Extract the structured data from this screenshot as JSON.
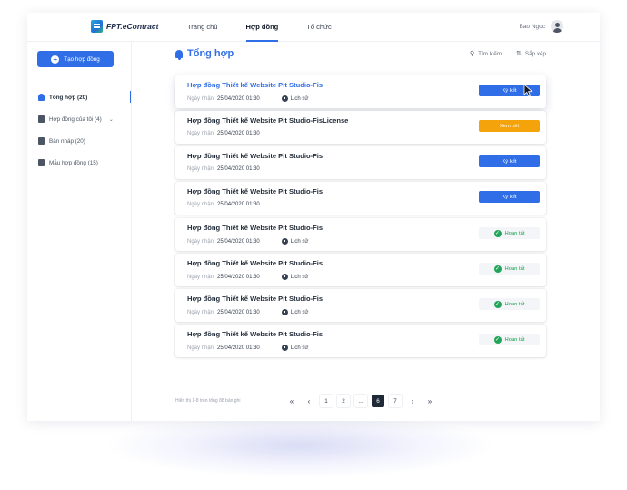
{
  "app": {
    "logo_text": "FPT.eContract"
  },
  "nav": {
    "items": [
      {
        "label": "Trang chủ",
        "active": false
      },
      {
        "label": "Hợp đồng",
        "active": true
      },
      {
        "label": "Tổ chức",
        "active": false
      }
    ]
  },
  "user": {
    "name": "Bao Ngoc"
  },
  "sidebar": {
    "create_label": "Tạo hợp đồng",
    "items": [
      {
        "label": "Tổng hợp (20)",
        "active": true
      },
      {
        "label": "Hợp đồng của tôi (4)",
        "active": false,
        "expandable": true
      },
      {
        "label": "Bản nháp (20)",
        "active": false
      },
      {
        "label": "Mẫu hợp đồng (15)",
        "active": false
      }
    ]
  },
  "main": {
    "title": "Tổng hợp",
    "search_label": "Tìm kiếm",
    "sort_label": "Sắp xếp",
    "received_label": "Ngày nhận",
    "history_label": "Lịch sử",
    "contracts": [
      {
        "title": "Hợp đồng Thiết kế Website Pit Studio-Fis",
        "date": "25/04/2020 01:30",
        "history": true,
        "action": "Ký kết",
        "status": "sign"
      },
      {
        "title": "Hợp đồng Thiết kế Website Pit Studio-FisLicense",
        "date": "25/04/2020 01:30",
        "history": false,
        "action": "Xem xét",
        "status": "review"
      },
      {
        "title": "Hợp đồng Thiết kế Website Pit Studio-Fis",
        "date": "25/04/2020 01:30",
        "history": false,
        "action": "Ký kết",
        "status": "sign"
      },
      {
        "title": "Hợp đồng Thiết kế Website Pit Studio-Fis",
        "date": "25/04/2020 01:30",
        "history": false,
        "action": "Ký kết",
        "status": "sign"
      },
      {
        "title": "Hợp đồng Thiết kế Website Pit Studio-Fis",
        "date": "25/04/2020 01:30",
        "history": true,
        "action": "Hoàn tất",
        "status": "done"
      },
      {
        "title": "Hợp đồng Thiết kế Website Pit Studio-Fis",
        "date": "25/04/2020 01:30",
        "history": true,
        "action": "Hoàn tất",
        "status": "done"
      },
      {
        "title": "Hợp đồng Thiết kế Website Pit Studio-Fis",
        "date": "25/04/2020 01:30",
        "history": true,
        "action": "Hoàn tất",
        "status": "done"
      },
      {
        "title": "Hợp đồng Thiết kế Website Pit Studio-Fis",
        "date": "25/04/2020 01:30",
        "history": true,
        "action": "Hoàn tất",
        "status": "done"
      }
    ]
  },
  "pagination": {
    "summary": "Hiển thị 1-8 trên tổng 88 bản ghi",
    "first": "«",
    "prev": "‹",
    "pages": [
      "1",
      "2",
      "...",
      "6",
      "7"
    ],
    "current": "6",
    "next": "›",
    "last": "»"
  },
  "colors": {
    "primary": "#2f6ee6",
    "warning": "#f5a30a",
    "success": "#22a55a"
  },
  "icons": {
    "search": "search-icon",
    "sort": "sort-icon",
    "bell": "bell-icon",
    "clock": "clock-icon",
    "check": "check-circle-icon",
    "cursor": "mouse-pointer-icon"
  }
}
